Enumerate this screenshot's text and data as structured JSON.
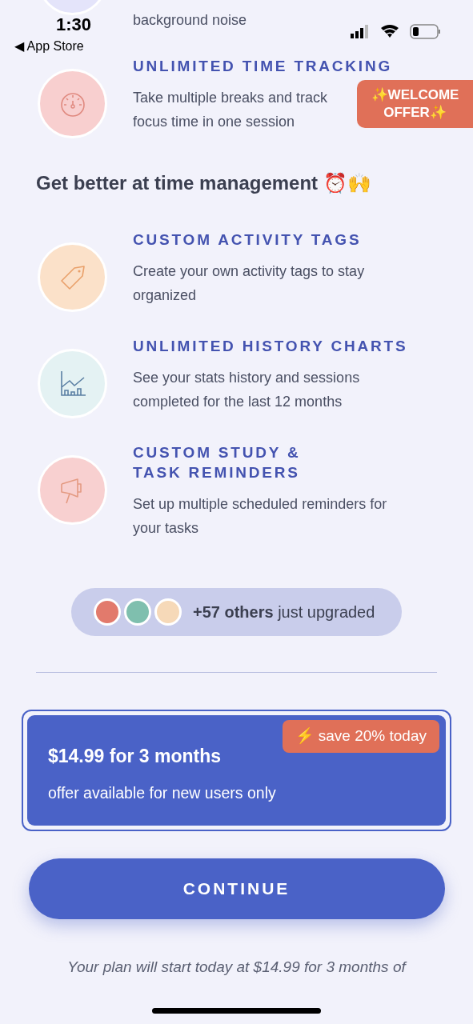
{
  "status_bar": {
    "time": "1:30",
    "back_label": "◀ App Store"
  },
  "welcome_badge": {
    "text": "✨WELCOME OFFER✨"
  },
  "feature_groups": [
    {
      "features": [
        {
          "color": "#e4e4fa",
          "description": "background noise"
        },
        {
          "kind": "stopwatch",
          "color": "#f8cfcf",
          "title": "UNLIMITED TIME TRACKING",
          "description": "Take multiple breaks and track focus time in one session"
        }
      ]
    },
    {
      "heading": "Get better at time management ⏰🙌",
      "features": [
        {
          "kind": "tag",
          "color": "#fbe1c9",
          "title": "CUSTOM ACTIVITY TAGS",
          "description": "Create your own activity tags to stay organized"
        },
        {
          "kind": "chart",
          "color": "#e4f2f3",
          "title": "UNLIMITED HISTORY CHARTS",
          "description": "See your stats history and sessions completed for the last 12 months"
        },
        {
          "kind": "megaphone",
          "color": "#f8d0d0",
          "title": "CUSTOM STUDY & TASK REMINDERS",
          "description": "Set up multiple scheduled reminders for your tasks"
        }
      ]
    }
  ],
  "social_proof": {
    "avatars": [
      {
        "color": "#e27a6c"
      },
      {
        "color": "#7fbfae"
      },
      {
        "color": "#f6d9b8"
      }
    ],
    "text": "**+57 others** just upgraded"
  },
  "plan": {
    "selected": true,
    "price": "$14.99 for 3 months",
    "note": "offer available for new users only",
    "tag": "⚡ save 20% today"
  },
  "continue_button": "CONTINUE",
  "footer_text": "Your plan will start today at $14.99 for 3 months of"
}
